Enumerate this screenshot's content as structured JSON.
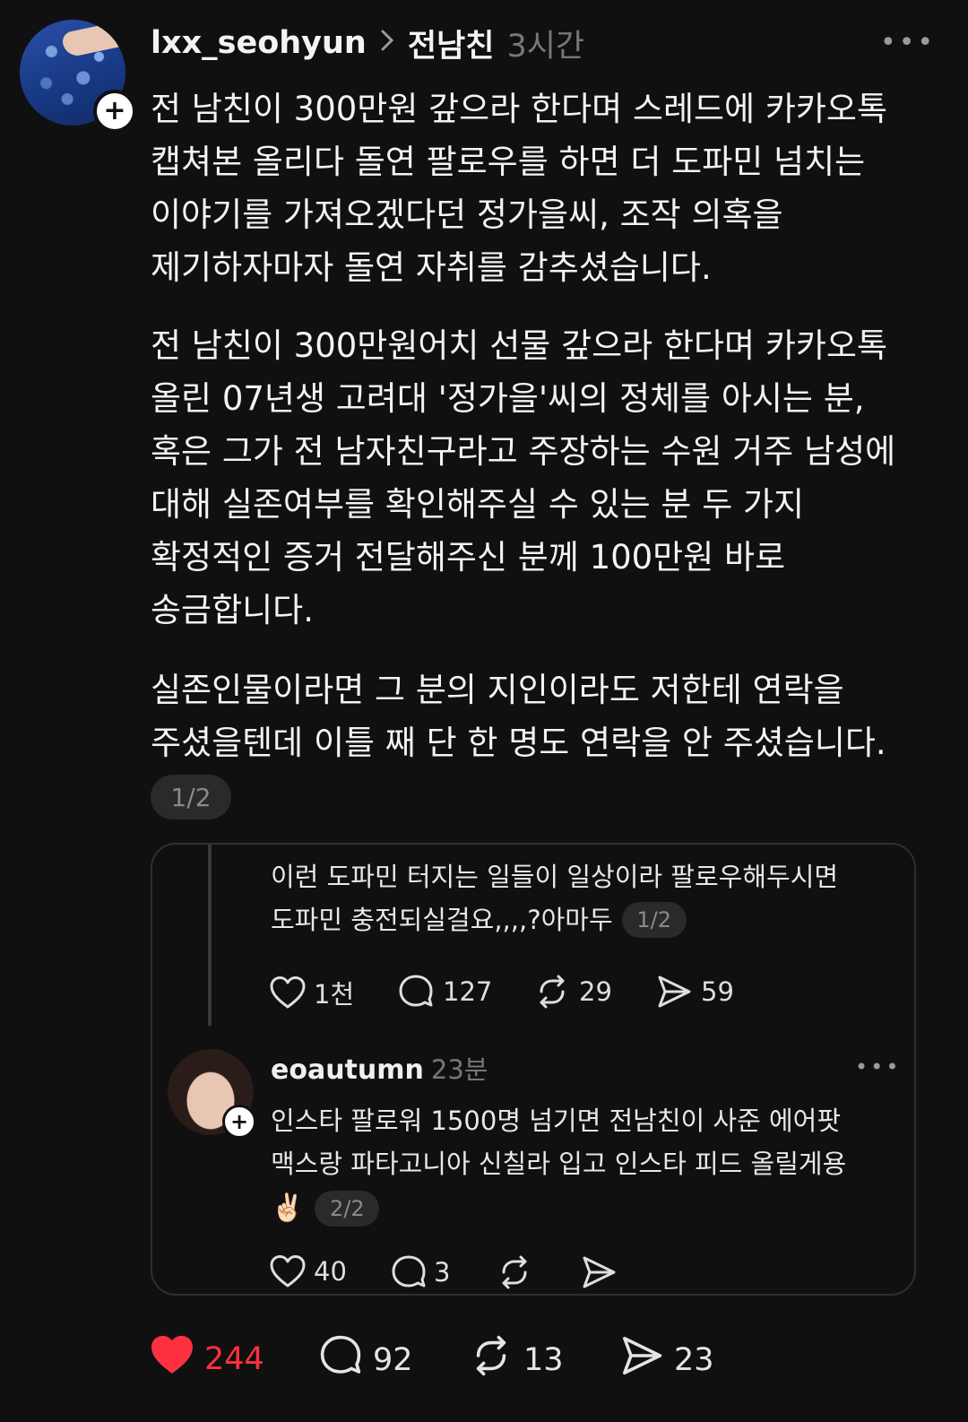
{
  "post": {
    "username": "lxx_seohyun",
    "topic": "전남친",
    "time": "3시간",
    "paragraphs": [
      [
        "전 남친이 300만원 갚으라 한다며 스레드에 카카오톡",
        "캡쳐본 올리다 돌연 팔로우를 하면 더 도파민 넘치는",
        "이야기를 가져오겠다던 정가을씨, 조작 의혹을",
        "제기하자마자 돌연 자취를 감추셨습니다."
      ],
      [
        "전 남친이 300만원어치 선물 갚으라 한다며 카카오톡",
        "올린 07년생 고려대 '정가을'씨의 정체를 아시는 분,",
        "혹은 그가 전 남자친구라고 주장하는 수원 거주 남성에",
        "대해 실존여부를 확인해주실 수 있는 분 두 가지",
        "확정적인 증거 전달해주신 분께 100만원 바로",
        "송금합니다."
      ],
      [
        "실존인물이라면 그 분의 지인이라도 저한테 연락을",
        "주셨을텐데 이틀 째 단 한 명도 연락을 안 주셨습니다."
      ]
    ],
    "page": "1/2",
    "stats": {
      "likes": "244",
      "comments": "92",
      "reposts": "13",
      "shares": "23"
    },
    "like_color": "#ff3040"
  },
  "quote": {
    "lines": [
      "이런 도파민 터지는 일들이 일상이라 팔로우해두시면",
      "도파민 충전되실걸요,,,,?아마두"
    ],
    "page": "1/2",
    "stats": {
      "likes": "1천",
      "comments": "127",
      "reposts": "29",
      "shares": "59"
    }
  },
  "reply": {
    "username": "eoautumn",
    "time": "23분",
    "lines": [
      "인스타 팔로워 1500명 넘기면 전남친이 사준 에어팟",
      "맥스랑 파타고니아 신칠라 입고 인스타 피드 올릴게용"
    ],
    "emoji": "✌🏻",
    "page": "2/2",
    "stats": {
      "likes": "40",
      "comments": "3"
    }
  }
}
